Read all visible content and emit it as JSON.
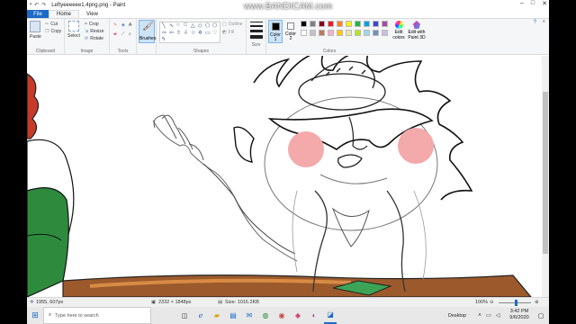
{
  "watermark": "www.BANDICAM.com",
  "window": {
    "title": "Leftyeeeeee1.4png.png - Paint",
    "controls": [
      "–",
      "□",
      "✕"
    ]
  },
  "tabs": {
    "file": "File",
    "home": "Home",
    "view": "View"
  },
  "ribbon": {
    "clipboard": {
      "paste": "Paste",
      "cut": "Cut",
      "copy": "Copy",
      "label": "Clipboard"
    },
    "image": {
      "select": "Select",
      "crop": "Crop",
      "resize": "Resize",
      "rotate": "Rotate",
      "label": "Image"
    },
    "tools": {
      "label": "Tools"
    },
    "brushes": {
      "label": "Brushes"
    },
    "shapes": {
      "outline": "Outline",
      "fill": "Fill",
      "label": "Shapes"
    },
    "size": {
      "label": "Size"
    },
    "colors": {
      "color1": "Color 1",
      "color2": "Color 2",
      "label": "Colors",
      "edit_colors": "Edit colors",
      "edit_paint3d": "Edit with Paint 3D",
      "palette": [
        "#000000",
        "#7f7f7f",
        "#880015",
        "#ed1c24",
        "#ff7f27",
        "#fff200",
        "#22b14c",
        "#00a2e8",
        "#3f48cc",
        "#a349a4",
        "#ffffff",
        "#c3c3c3",
        "#b97a57",
        "#ffaec9",
        "#ffc90e",
        "#efe4b0",
        "#b5e61d",
        "#99d9ea",
        "#7092be",
        "#c8bfe7"
      ]
    }
  },
  "status": {
    "cursor": "1955, 607px",
    "image_size": "2332 × 1848px",
    "file_size": "Size: 1016.2KB",
    "zoom": "100%"
  },
  "taskbar": {
    "search_placeholder": "Type here to search",
    "desktop": "Desktop",
    "time": "3:42 PM",
    "date": "9/6/2020"
  }
}
